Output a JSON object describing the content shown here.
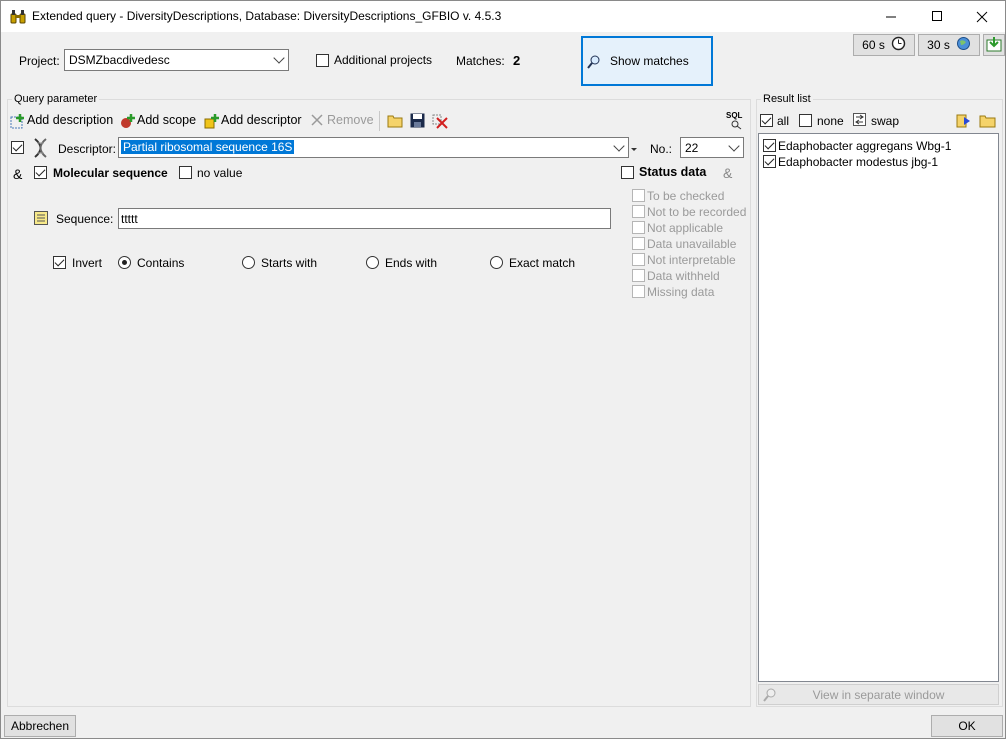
{
  "window": {
    "title": "Extended query - DiversityDescriptions,  Database: DiversityDescriptions_GFBIO    v. 4.5.3",
    "minimize": "—",
    "maximize": "☐",
    "close": "✕"
  },
  "top": {
    "project_label": "Project:",
    "project_value": "DSMZbacdivedesc",
    "additional_projects_label": "Additional projects",
    "matches_label": "Matches:",
    "matches_value": "2",
    "show_matches_label": "Show matches",
    "timer1": "60 s",
    "timer2": "30 s"
  },
  "query": {
    "group_label": "Query parameter",
    "toolbar": {
      "add_description": "Add description",
      "add_scope": "Add scope",
      "add_descriptor": "Add descriptor",
      "remove": "Remove",
      "sql": "SQL"
    },
    "descriptor_label": "Descriptor:",
    "descriptor_value": "Partial ribosomal sequence 16S",
    "no_label": "No.:",
    "no_value": "22",
    "and_symbol": "&",
    "molecular_sequence_label": "Molecular sequence",
    "no_value_label": "no value",
    "status_data_label": "Status data",
    "status_and_symbol": "&",
    "status_items": [
      "To be checked",
      "Not to be recorded",
      "Not applicable",
      "Data unavailable",
      "Not interpretable",
      "Data withheld",
      "Missing data"
    ],
    "sequence_label": "Sequence:",
    "sequence_value": "ttttt",
    "invert_label": "Invert",
    "match_options": [
      "Contains",
      "Starts with",
      "Ends with",
      "Exact match"
    ],
    "selected_match": "Contains"
  },
  "result": {
    "group_label": "Result list",
    "all_label": "all",
    "none_label": "none",
    "swap_label": "swap",
    "items": [
      "Edaphobacter aggregans Wbg-1",
      "Edaphobacter modestus jbg-1"
    ],
    "view_separate_label": "View in separate window"
  },
  "footer": {
    "cancel_label": "Abbrechen",
    "ok_label": "OK"
  },
  "colors": {
    "accent": "#0078d7",
    "selection": "#0078d7",
    "window_bg": "#f0f0f0"
  }
}
